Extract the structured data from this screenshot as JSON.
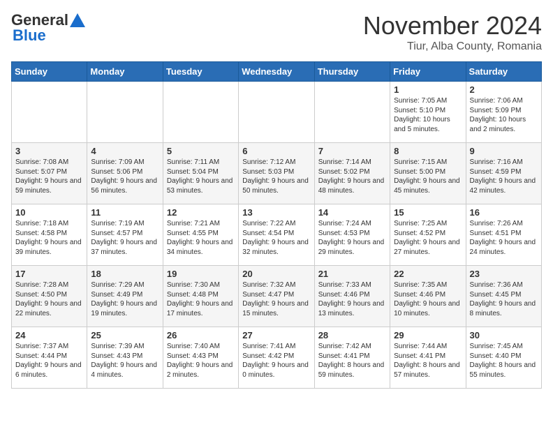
{
  "header": {
    "logo_general": "General",
    "logo_blue": "Blue",
    "month_title": "November 2024",
    "subtitle": "Tiur, Alba County, Romania"
  },
  "weekdays": [
    "Sunday",
    "Monday",
    "Tuesday",
    "Wednesday",
    "Thursday",
    "Friday",
    "Saturday"
  ],
  "weeks": [
    [
      {
        "day": "",
        "info": ""
      },
      {
        "day": "",
        "info": ""
      },
      {
        "day": "",
        "info": ""
      },
      {
        "day": "",
        "info": ""
      },
      {
        "day": "",
        "info": ""
      },
      {
        "day": "1",
        "info": "Sunrise: 7:05 AM\nSunset: 5:10 PM\nDaylight: 10 hours and 5 minutes."
      },
      {
        "day": "2",
        "info": "Sunrise: 7:06 AM\nSunset: 5:09 PM\nDaylight: 10 hours and 2 minutes."
      }
    ],
    [
      {
        "day": "3",
        "info": "Sunrise: 7:08 AM\nSunset: 5:07 PM\nDaylight: 9 hours and 59 minutes."
      },
      {
        "day": "4",
        "info": "Sunrise: 7:09 AM\nSunset: 5:06 PM\nDaylight: 9 hours and 56 minutes."
      },
      {
        "day": "5",
        "info": "Sunrise: 7:11 AM\nSunset: 5:04 PM\nDaylight: 9 hours and 53 minutes."
      },
      {
        "day": "6",
        "info": "Sunrise: 7:12 AM\nSunset: 5:03 PM\nDaylight: 9 hours and 50 minutes."
      },
      {
        "day": "7",
        "info": "Sunrise: 7:14 AM\nSunset: 5:02 PM\nDaylight: 9 hours and 48 minutes."
      },
      {
        "day": "8",
        "info": "Sunrise: 7:15 AM\nSunset: 5:00 PM\nDaylight: 9 hours and 45 minutes."
      },
      {
        "day": "9",
        "info": "Sunrise: 7:16 AM\nSunset: 4:59 PM\nDaylight: 9 hours and 42 minutes."
      }
    ],
    [
      {
        "day": "10",
        "info": "Sunrise: 7:18 AM\nSunset: 4:58 PM\nDaylight: 9 hours and 39 minutes."
      },
      {
        "day": "11",
        "info": "Sunrise: 7:19 AM\nSunset: 4:57 PM\nDaylight: 9 hours and 37 minutes."
      },
      {
        "day": "12",
        "info": "Sunrise: 7:21 AM\nSunset: 4:55 PM\nDaylight: 9 hours and 34 minutes."
      },
      {
        "day": "13",
        "info": "Sunrise: 7:22 AM\nSunset: 4:54 PM\nDaylight: 9 hours and 32 minutes."
      },
      {
        "day": "14",
        "info": "Sunrise: 7:24 AM\nSunset: 4:53 PM\nDaylight: 9 hours and 29 minutes."
      },
      {
        "day": "15",
        "info": "Sunrise: 7:25 AM\nSunset: 4:52 PM\nDaylight: 9 hours and 27 minutes."
      },
      {
        "day": "16",
        "info": "Sunrise: 7:26 AM\nSunset: 4:51 PM\nDaylight: 9 hours and 24 minutes."
      }
    ],
    [
      {
        "day": "17",
        "info": "Sunrise: 7:28 AM\nSunset: 4:50 PM\nDaylight: 9 hours and 22 minutes."
      },
      {
        "day": "18",
        "info": "Sunrise: 7:29 AM\nSunset: 4:49 PM\nDaylight: 9 hours and 19 minutes."
      },
      {
        "day": "19",
        "info": "Sunrise: 7:30 AM\nSunset: 4:48 PM\nDaylight: 9 hours and 17 minutes."
      },
      {
        "day": "20",
        "info": "Sunrise: 7:32 AM\nSunset: 4:47 PM\nDaylight: 9 hours and 15 minutes."
      },
      {
        "day": "21",
        "info": "Sunrise: 7:33 AM\nSunset: 4:46 PM\nDaylight: 9 hours and 13 minutes."
      },
      {
        "day": "22",
        "info": "Sunrise: 7:35 AM\nSunset: 4:46 PM\nDaylight: 9 hours and 10 minutes."
      },
      {
        "day": "23",
        "info": "Sunrise: 7:36 AM\nSunset: 4:45 PM\nDaylight: 9 hours and 8 minutes."
      }
    ],
    [
      {
        "day": "24",
        "info": "Sunrise: 7:37 AM\nSunset: 4:44 PM\nDaylight: 9 hours and 6 minutes."
      },
      {
        "day": "25",
        "info": "Sunrise: 7:39 AM\nSunset: 4:43 PM\nDaylight: 9 hours and 4 minutes."
      },
      {
        "day": "26",
        "info": "Sunrise: 7:40 AM\nSunset: 4:43 PM\nDaylight: 9 hours and 2 minutes."
      },
      {
        "day": "27",
        "info": "Sunrise: 7:41 AM\nSunset: 4:42 PM\nDaylight: 9 hours and 0 minutes."
      },
      {
        "day": "28",
        "info": "Sunrise: 7:42 AM\nSunset: 4:41 PM\nDaylight: 8 hours and 59 minutes."
      },
      {
        "day": "29",
        "info": "Sunrise: 7:44 AM\nSunset: 4:41 PM\nDaylight: 8 hours and 57 minutes."
      },
      {
        "day": "30",
        "info": "Sunrise: 7:45 AM\nSunset: 4:40 PM\nDaylight: 8 hours and 55 minutes."
      }
    ]
  ]
}
